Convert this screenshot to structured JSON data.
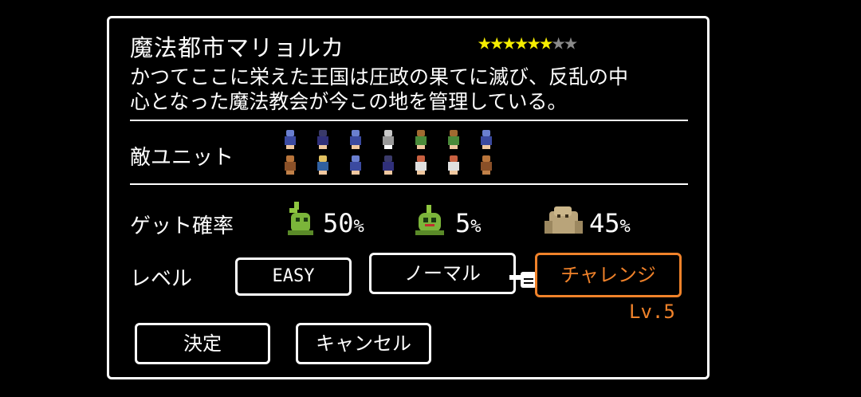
{
  "stage": {
    "title": "魔法都市マリョルカ",
    "difficulty_stars": 6,
    "max_stars": 8,
    "description_line1": "かつてここに栄えた王国は圧政の果てに滅び、反乱の中",
    "description_line2": "心となった魔法教会が今この地を管理している。"
  },
  "enemy_units": {
    "label": "敵ユニット",
    "row1": [
      {
        "name": "sorceress-sprite",
        "hair": "#6a7fd0",
        "body": "#3b4aa0",
        "skin": "#f0c8a0"
      },
      {
        "name": "mage-sprite",
        "hair": "#3a3a6a",
        "body": "#30307a",
        "skin": "#f0c8a0"
      },
      {
        "name": "sorceress-sprite",
        "hair": "#6a7fd0",
        "body": "#3b4aa0",
        "skin": "#f0c8a0"
      },
      {
        "name": "knight-sprite",
        "hair": "#c8c8c8",
        "body": "#9a9a9a",
        "skin": "#ffffff"
      },
      {
        "name": "ranger-sprite",
        "hair": "#a06a30",
        "body": "#4a8a3a",
        "skin": "#f0c8a0"
      },
      {
        "name": "ranger-sprite",
        "hair": "#a06a30",
        "body": "#4a8a3a",
        "skin": "#f0c8a0"
      },
      {
        "name": "sorceress-sprite",
        "hair": "#6a7fd0",
        "body": "#3b4aa0",
        "skin": "#f0c8a0"
      }
    ],
    "row2": [
      {
        "name": "hooded-sprite",
        "hair": "#b8743a",
        "body": "#8a5028",
        "skin": "#c08048"
      },
      {
        "name": "rider-sprite",
        "hair": "#e0c060",
        "body": "#3060a0",
        "skin": "#f0c8a0"
      },
      {
        "name": "sorceress-sprite",
        "hair": "#6a7fd0",
        "body": "#3b4aa0",
        "skin": "#f0c8a0"
      },
      {
        "name": "mage-sprite",
        "hair": "#3a3a6a",
        "body": "#30307a",
        "skin": "#f0c8a0"
      },
      {
        "name": "cleric-sprite",
        "hair": "#c86040",
        "body": "#e0e0e0",
        "skin": "#f0c8a0"
      },
      {
        "name": "cleric-sprite",
        "hair": "#c86040",
        "body": "#e0e0e0",
        "skin": "#f0c8a0"
      },
      {
        "name": "hooded-sprite",
        "hair": "#b8743a",
        "body": "#8a5028",
        "skin": "#c08048"
      }
    ]
  },
  "drop_rate": {
    "label": "ゲット確率",
    "items": [
      {
        "monster": "green-slime-plant-icon",
        "value": "50",
        "unit": "%"
      },
      {
        "monster": "green-slime-icon",
        "value": "5",
        "unit": "%"
      },
      {
        "monster": "rock-golem-icon",
        "value": "45",
        "unit": "%"
      }
    ]
  },
  "level": {
    "label": "レベル",
    "options": [
      "EASY",
      "ノーマル",
      "チャレンジ"
    ],
    "selected": "チャレンジ",
    "selected_level": "Lv.5"
  },
  "actions": {
    "confirm": "決定",
    "cancel": "キャンセル"
  },
  "colors": {
    "star_on": "#f6ee00",
    "star_off": "#8a8a8a",
    "accent": "#f0822a"
  }
}
